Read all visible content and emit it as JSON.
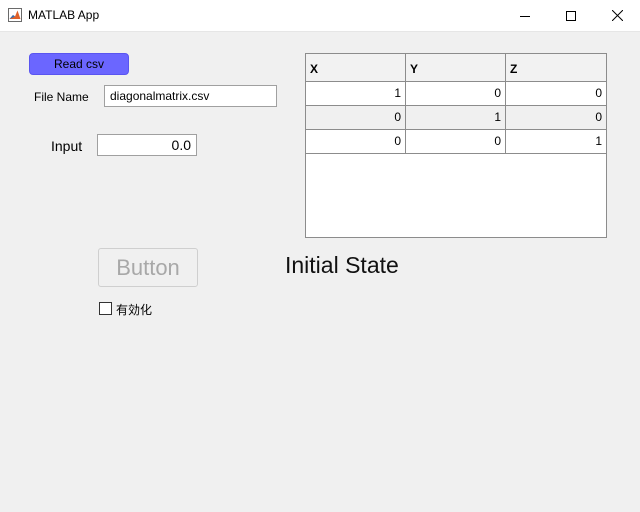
{
  "window": {
    "title": "MATLAB App",
    "icon": "matlab-logo-icon",
    "controls": [
      "minimize-icon",
      "maximize-icon",
      "close-icon"
    ]
  },
  "read_button": {
    "label": "Read csv",
    "color": "#6b66ff"
  },
  "file_name": {
    "label": "File Name",
    "value": "diagonalmatrix.csv"
  },
  "input": {
    "label": "Input",
    "value": "0.0"
  },
  "table": {
    "columns": [
      "X",
      "Y",
      "Z"
    ],
    "rows": [
      [
        "1",
        "0",
        "0"
      ],
      [
        "0",
        "1",
        "0"
      ],
      [
        "0",
        "0",
        "1"
      ]
    ]
  },
  "action_button": {
    "label": "Button",
    "enabled": false
  },
  "state_label": "Initial State",
  "checkbox": {
    "label": "有効化",
    "checked": false
  }
}
